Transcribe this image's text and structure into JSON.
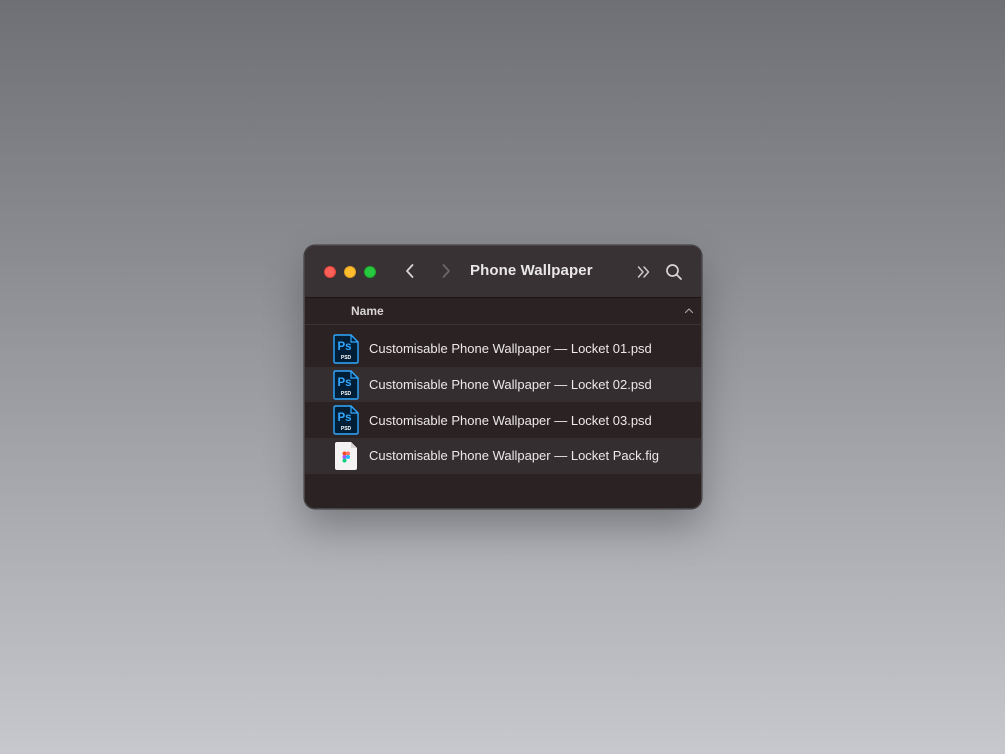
{
  "window": {
    "title": "Phone Wallpaper"
  },
  "toolbar": {
    "back_icon": "chevron-left-icon",
    "forward_icon": "chevron-right-icon",
    "more_icon": "double-chevron-right-icon",
    "search_icon": "magnifying-glass-icon"
  },
  "columns": {
    "name_label": "Name",
    "sort_icon": "chevron-up-icon"
  },
  "files": [
    {
      "name": "Customisable Phone Wallpaper — Locket 01.psd",
      "icon": "photoshop-file-icon",
      "icon_badge": "Ps",
      "icon_sub": "PSD"
    },
    {
      "name": "Customisable Phone Wallpaper — Locket 02.psd",
      "icon": "photoshop-file-icon",
      "icon_badge": "Ps",
      "icon_sub": "PSD"
    },
    {
      "name": "Customisable Phone Wallpaper — Locket 03.psd",
      "icon": "photoshop-file-icon",
      "icon_badge": "Ps",
      "icon_sub": "PSD"
    },
    {
      "name": "Customisable Phone Wallpaper — Locket Pack.fig",
      "icon": "figma-file-icon"
    }
  ],
  "colors": {
    "close": "#fe5f57",
    "minimize": "#febc2e",
    "zoom": "#28c840",
    "photoshop_blue": "#31a8ff",
    "photoshop_bg": "#001e36"
  }
}
